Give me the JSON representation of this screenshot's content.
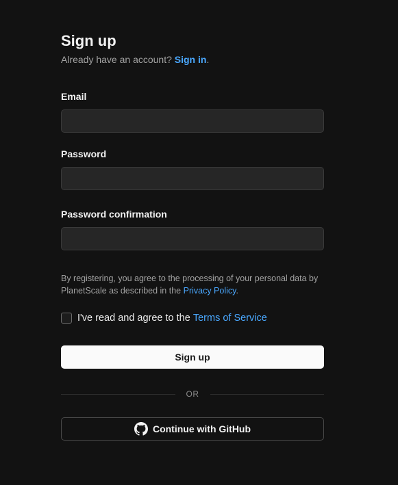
{
  "header": {
    "title": "Sign up",
    "subtitle_prefix": "Already have an account?",
    "signin_link": "Sign in",
    "subtitle_suffix": "."
  },
  "fields": {
    "email": {
      "label": "Email",
      "value": "",
      "placeholder": ""
    },
    "password": {
      "label": "Password",
      "value": "",
      "placeholder": ""
    },
    "password_confirmation": {
      "label": "Password confirmation",
      "value": "",
      "placeholder": ""
    }
  },
  "legal": {
    "text": "By registering, you agree to the processing of your personal data by PlanetScale as described in the",
    "link": "Privacy Policy",
    "suffix": "."
  },
  "agree": {
    "checked": false,
    "text": "I've read and agree to the",
    "link": "Terms of Service"
  },
  "buttons": {
    "signup": "Sign up",
    "divider": "OR",
    "github": "Continue with GitHub"
  },
  "icons": {
    "github": "github-icon"
  },
  "colors": {
    "background": "#121212",
    "link": "#4aa8ff",
    "input_bg": "#262626",
    "primary_button_bg": "#fafafa"
  }
}
